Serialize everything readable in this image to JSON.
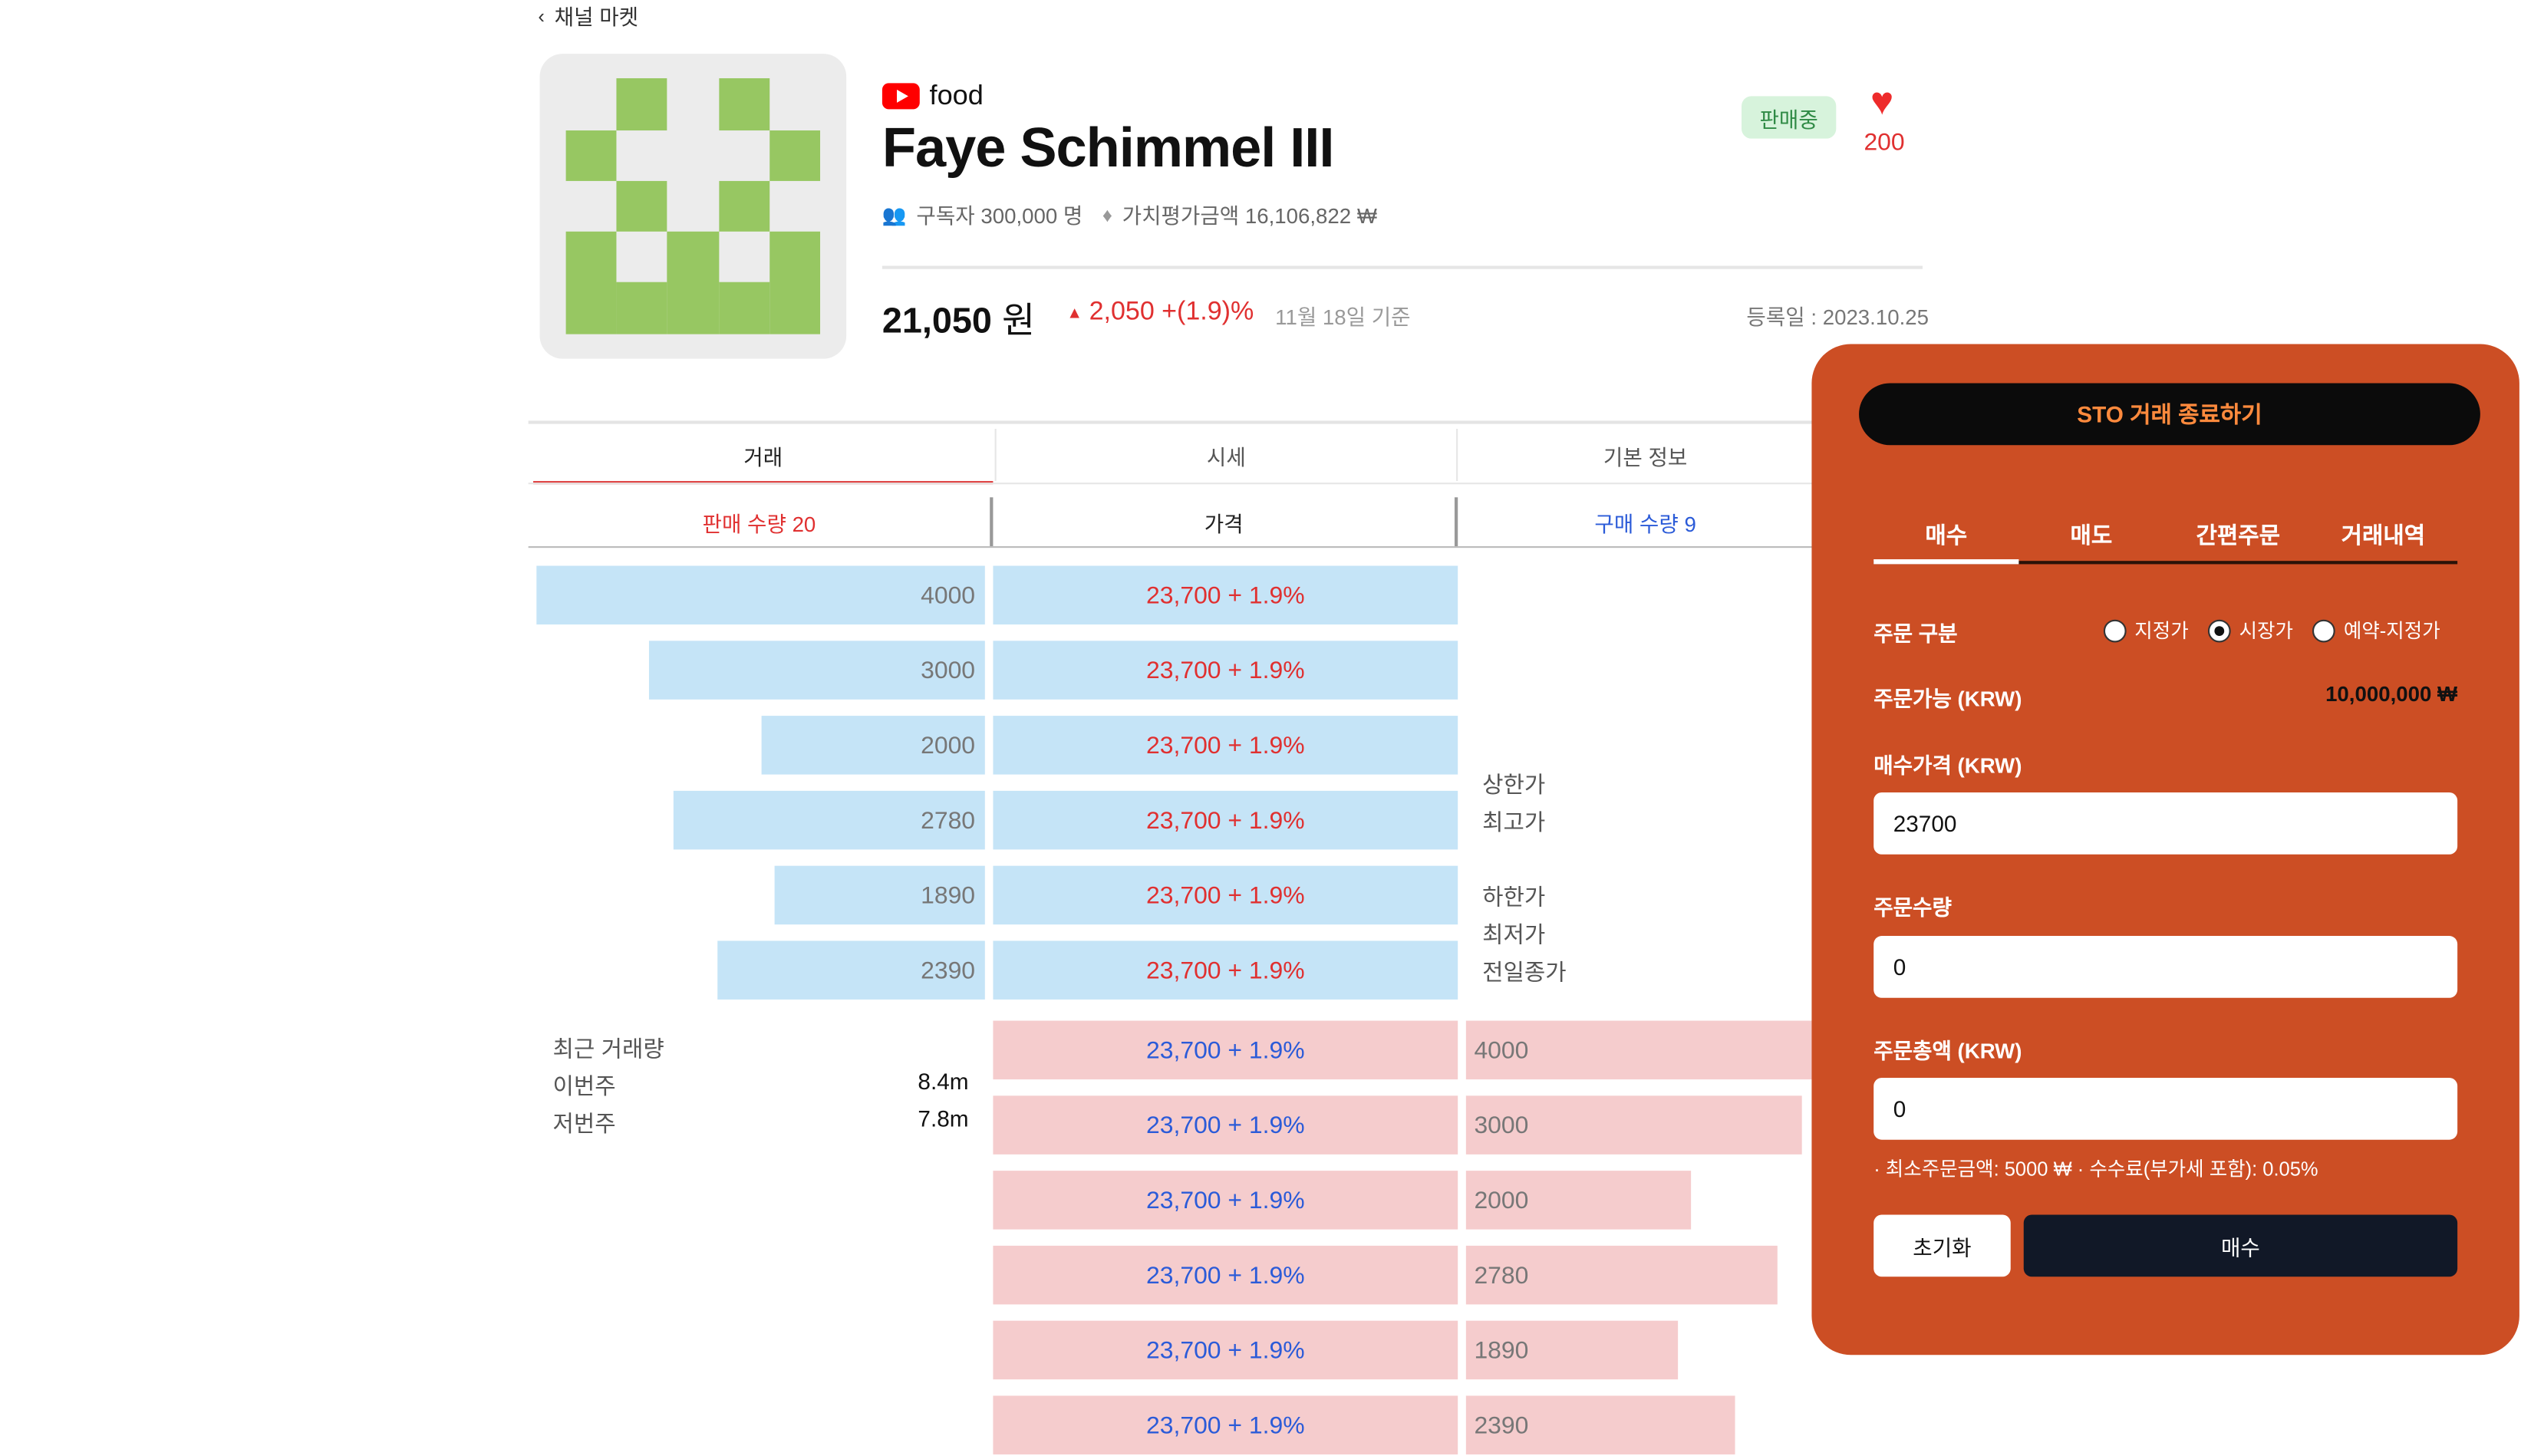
{
  "back_label": "채널 마켓",
  "channel": {
    "category": "food",
    "name": "Faye Schimmel III",
    "subscribers": "구독자 300,000 명",
    "valuation": "가치평가금액 16,106,822 ₩",
    "status_badge": "판매중",
    "likes": "200",
    "price": "21,050",
    "price_unit": "원",
    "change": "2,050 +(1.9)%",
    "as_of": "11월 18일 기준",
    "registered": "등록일 : 2023.10.25"
  },
  "tabs": [
    "거래",
    "시세",
    "기본 정보"
  ],
  "headers": {
    "sell": "판매 수량 20",
    "price": "가격",
    "buy": "구매 수량 9"
  },
  "sell_orders": [
    {
      "qty": "4000",
      "price": "23,700 + 1.9%",
      "ratio": 1.0
    },
    {
      "qty": "3000",
      "price": "23,700 + 1.9%",
      "ratio": 0.76
    },
    {
      "qty": "2000",
      "price": "23,700 + 1.9%",
      "ratio": 0.5
    },
    {
      "qty": "2780",
      "price": "23,700 + 1.9%",
      "ratio": 0.69
    },
    {
      "qty": "1890",
      "price": "23,700 + 1.9%",
      "ratio": 0.47
    },
    {
      "qty": "2390",
      "price": "23,700 + 1.9%",
      "ratio": 0.59
    }
  ],
  "buy_orders": [
    {
      "qty": "4000",
      "price": "23,700 + 1.9%",
      "ratio": 1.0
    },
    {
      "qty": "3000",
      "price": "23,700 + 1.9%",
      "ratio": 0.97
    },
    {
      "qty": "2000",
      "price": "23,700 + 1.9%",
      "ratio": 0.65
    },
    {
      "qty": "2780",
      "price": "23,700 + 1.9%",
      "ratio": 0.89
    },
    {
      "qty": "1890",
      "price": "23,700 + 1.9%",
      "ratio": 0.62
    },
    {
      "qty": "2390",
      "price": "23,700 + 1.9%",
      "ratio": 0.77
    }
  ],
  "price_info": {
    "upper_limit": "상한가",
    "high": "최고가",
    "lower_limit": "하한가",
    "low": "최저가",
    "prev_close": "전일종가"
  },
  "volume": {
    "title": "최근 거래량",
    "this_week_label": "이번주",
    "this_week_value": "8.4m",
    "last_week_label": "저번주",
    "last_week_value": "7.8m"
  },
  "order_panel": {
    "end_button": "STO 거래 종료하기",
    "tabs": [
      "매수",
      "매도",
      "간편주문",
      "거래내역"
    ],
    "order_type_label": "주문 구분",
    "order_types": [
      "지정가",
      "시장가",
      "예약-지정가"
    ],
    "selected_order_type": "시장가",
    "available_label": "주문가능 (KRW)",
    "available_value": "10,000,000 ₩",
    "buy_price_label": "매수가격 (KRW)",
    "buy_price_value": "23700",
    "quantity_label": "주문수량",
    "quantity_value": "0",
    "total_label": "주문총액 (KRW)",
    "total_value": "0",
    "note": "· 최소주문금액: 5000 ₩ · 수수료(부가세 포함): 0.05%",
    "reset_button": "초기화",
    "buy_button": "매수"
  },
  "colors": {
    "panel": "#cc4e24",
    "sell_bar": "#c5e4f7",
    "buy_bar": "#f5cccd",
    "up_red": "#e03030",
    "down_blue": "#2b5bd8"
  }
}
